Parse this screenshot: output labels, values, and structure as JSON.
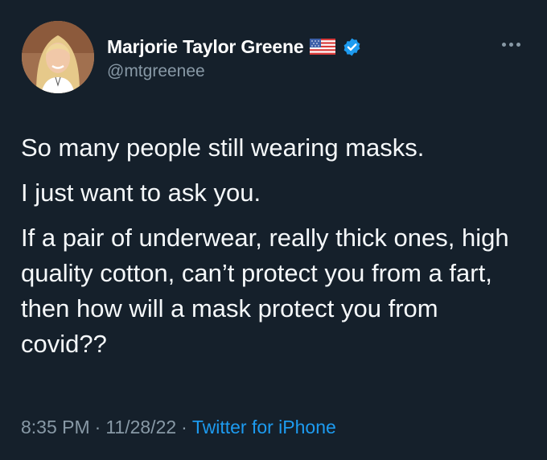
{
  "author": {
    "display_name": "Marjorie Taylor Greene",
    "handle": "@mtgreenee",
    "badge_icons": [
      "us-flag-icon",
      "verified-icon"
    ]
  },
  "tweet": {
    "paragraphs": [
      "So many people still wearing masks.",
      "I just want to ask you.",
      "If a pair of underwear, really thick ones, high quality cotton, can’t protect you from a fart, then how will a mask protect you from covid??"
    ],
    "time": "8:35 PM",
    "separator": "·",
    "date": "11/28/22",
    "source": "Twitter for iPhone"
  },
  "colors": {
    "background": "#15202b",
    "text": "#f5f8fa",
    "secondary_text": "#8899a6",
    "link": "#1d9bf0",
    "verified": "#1d9bf0"
  }
}
